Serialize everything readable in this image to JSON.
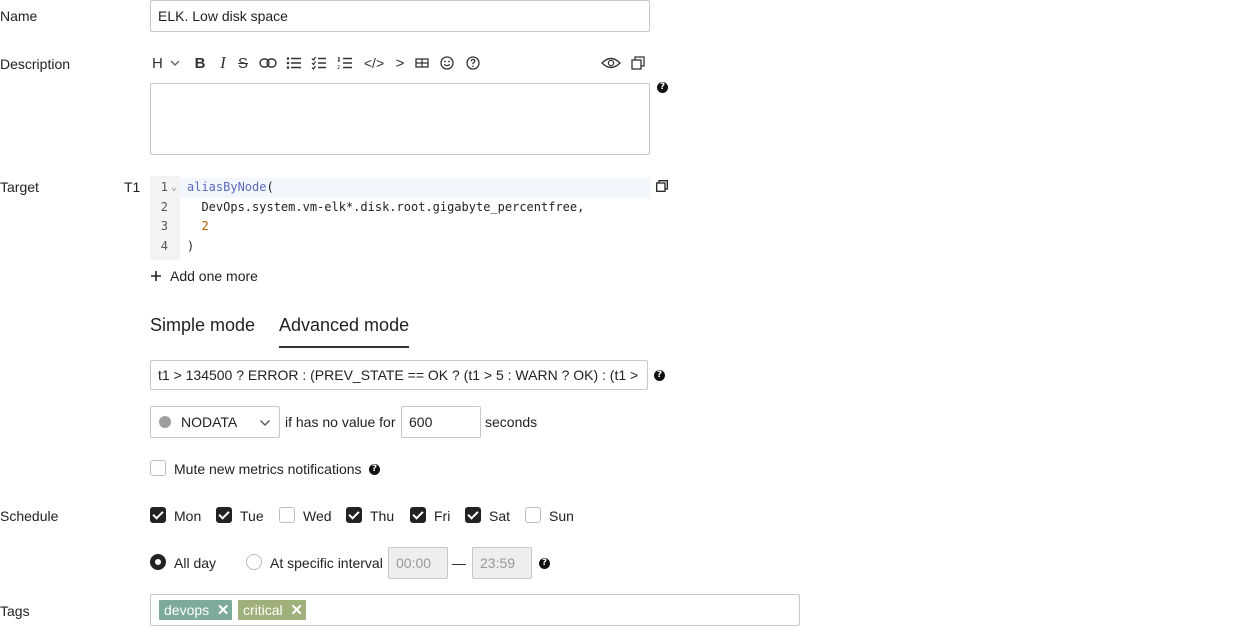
{
  "form": {
    "name_label": "Name",
    "name_value": "ELK. Low disk space",
    "description_label": "Description",
    "target_label": "Target",
    "schedule_label": "Schedule",
    "tags_label": "Tags"
  },
  "editor_toolbar": {
    "heading": "H",
    "bold": "B",
    "italic": "I",
    "strikethrough": "S",
    "code": "</>",
    "quote": ">"
  },
  "target": {
    "id": "T1",
    "lines": [
      {
        "n": "1",
        "fn": "aliasByNode",
        "rest": "("
      },
      {
        "n": "2",
        "text": "  DevOps.system.vm-elk*.disk.root.gigabyte_percentfree,"
      },
      {
        "n": "3",
        "num": "2"
      },
      {
        "n": "4",
        "text": ")"
      }
    ],
    "add_more_label": "Add one more"
  },
  "modes": {
    "simple": "Simple mode",
    "advanced": "Advanced mode",
    "active": "advanced"
  },
  "expression": "t1 > 134500 ? ERROR : (PREV_STATE == OK ? (t1 > 5 : WARN ? OK) : (t1 >",
  "nodata": {
    "state": "NODATA",
    "state_color": "#9e9e9e",
    "prefix": "if has no value for",
    "value": "600",
    "suffix": "seconds"
  },
  "mute": {
    "label": "Mute new metrics notifications",
    "checked": false
  },
  "schedule": {
    "days": [
      {
        "label": "Mon",
        "checked": true
      },
      {
        "label": "Tue",
        "checked": true
      },
      {
        "label": "Wed",
        "checked": false
      },
      {
        "label": "Thu",
        "checked": true
      },
      {
        "label": "Fri",
        "checked": true
      },
      {
        "label": "Sat",
        "checked": true
      },
      {
        "label": "Sun",
        "checked": false
      }
    ],
    "all_day_label": "All day",
    "interval_label": "At specific interval",
    "mode": "all_day",
    "from": "00:00",
    "dash": "—",
    "to": "23:59"
  },
  "tags": [
    {
      "label": "devops",
      "color": "#7cab9a"
    },
    {
      "label": "critical",
      "color": "#9fb07a"
    }
  ],
  "help_glyph": "?"
}
